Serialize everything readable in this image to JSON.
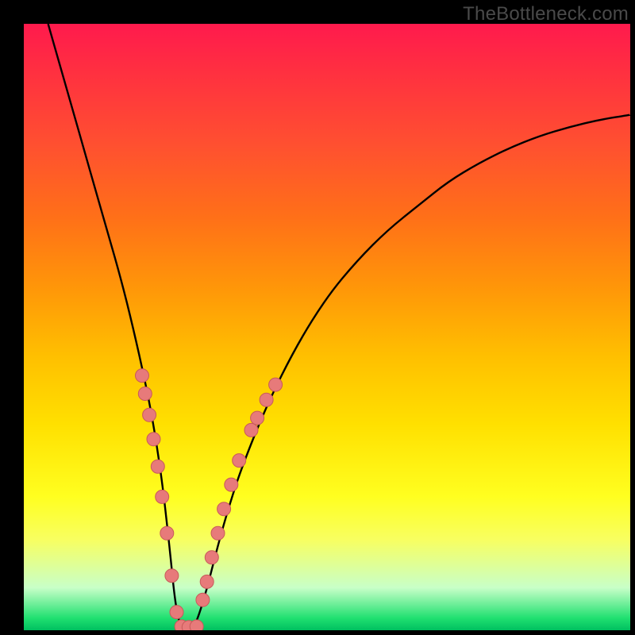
{
  "watermark": "TheBottleneck.com",
  "colors": {
    "curve_stroke": "#000000",
    "dot_fill": "#e77a7a",
    "dot_stroke": "#c85a5a"
  },
  "chart_data": {
    "type": "line",
    "title": "",
    "xlabel": "",
    "ylabel": "",
    "xlim": [
      0,
      100
    ],
    "ylim": [
      0,
      100
    ],
    "series": [
      {
        "name": "bottleneck-curve",
        "x": [
          4,
          6,
          8,
          10,
          12,
          14,
          16,
          18,
          20,
          21,
          22,
          23,
          24,
          25,
          26,
          27,
          28,
          30,
          32,
          34,
          36,
          40,
          45,
          50,
          55,
          60,
          65,
          70,
          75,
          80,
          85,
          90,
          95,
          100
        ],
        "y": [
          100,
          93,
          86,
          79,
          72,
          65,
          58,
          50,
          41,
          36,
          30,
          23,
          14,
          4,
          0,
          0,
          0,
          6,
          14,
          21,
          27,
          37,
          47,
          55,
          61,
          66,
          70,
          74,
          77,
          79.5,
          81.5,
          83,
          84.2,
          85
        ]
      }
    ],
    "dots_left": [
      {
        "x": 19.5,
        "y": 42
      },
      {
        "x": 20.0,
        "y": 39
      },
      {
        "x": 20.7,
        "y": 35.5
      },
      {
        "x": 21.4,
        "y": 31.5
      },
      {
        "x": 22.1,
        "y": 27
      },
      {
        "x": 22.8,
        "y": 22
      },
      {
        "x": 23.6,
        "y": 16
      },
      {
        "x": 24.4,
        "y": 9
      },
      {
        "x": 25.2,
        "y": 3
      }
    ],
    "dots_bottom": [
      {
        "x": 26.0,
        "y": 0.6
      },
      {
        "x": 27.2,
        "y": 0.5
      },
      {
        "x": 28.5,
        "y": 0.6
      }
    ],
    "dots_right": [
      {
        "x": 29.5,
        "y": 5
      },
      {
        "x": 30.2,
        "y": 8
      },
      {
        "x": 31.0,
        "y": 12
      },
      {
        "x": 32.0,
        "y": 16
      },
      {
        "x": 33.0,
        "y": 20
      },
      {
        "x": 34.2,
        "y": 24
      },
      {
        "x": 35.5,
        "y": 28
      },
      {
        "x": 37.5,
        "y": 33
      },
      {
        "x": 38.5,
        "y": 35
      },
      {
        "x": 40.0,
        "y": 38
      },
      {
        "x": 41.5,
        "y": 40.5
      }
    ]
  }
}
